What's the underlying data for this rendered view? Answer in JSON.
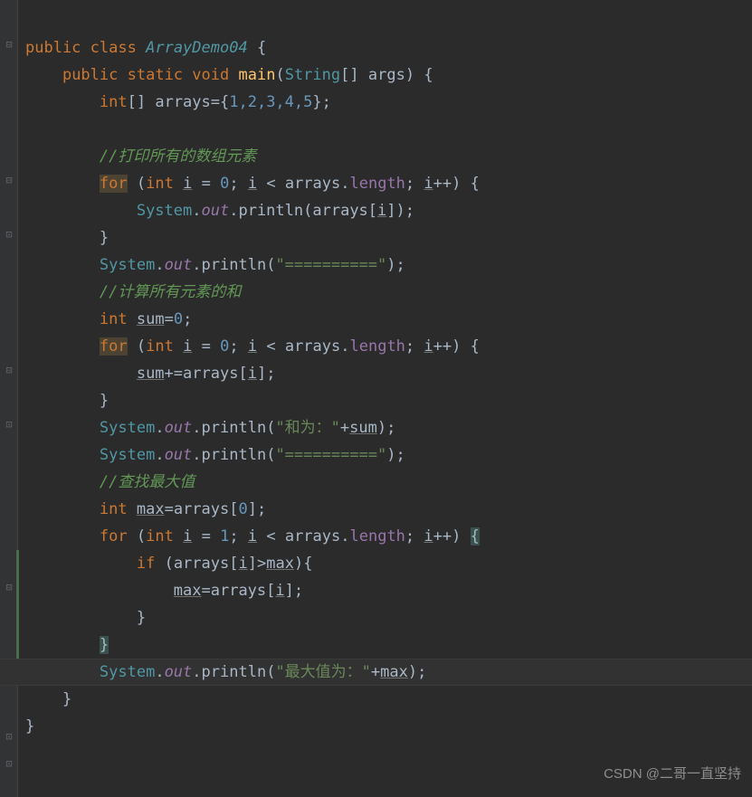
{
  "code": {
    "class_decl_public": "public",
    "class_decl_class": "class",
    "class_name": "ArrayDemo04",
    "brace_open": "{",
    "brace_close": "}",
    "main_public": "public",
    "main_static": "static",
    "main_void": "void",
    "main_name": "main",
    "main_param_type": "String",
    "main_param_brackets": "[]",
    "main_param_name": "args",
    "int_kw": "int",
    "arrays_decl_name": "arrays",
    "arrays_decl_vals": "1,2,3,4,5",
    "comment1": "//打印所有的数组元素",
    "for_kw": "for",
    "i_var": "i",
    "eq": "=",
    "zero": "0",
    "one": "1",
    "lt": "<",
    "arrays_ref": "arrays",
    "length_prop": "length",
    "ipp": "++",
    "system": "System",
    "out": "out",
    "println": "println",
    "sep_str": "\"==========\"",
    "comment2": "//计算所有元素的和",
    "sum_var": "sum",
    "plus_eq": "+=",
    "sum_str": "\"和为：\"",
    "plus": "+",
    "comment3": "//查找最大值",
    "max_var": "max",
    "if_kw": "if",
    "gt": ">",
    "max_str": "\"最大值为：\"",
    "semi": ";",
    "dot": ".",
    "lparen": "(",
    "rparen": ")",
    "lbrack": "[",
    "rbrack": "]",
    "brackets_decl": "[]"
  },
  "watermark": "CSDN @二哥一直坚持"
}
